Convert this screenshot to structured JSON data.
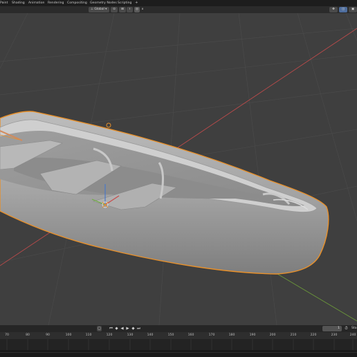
{
  "workspace_tabs": [
    "Paint",
    "Shading",
    "Animation",
    "Rendering",
    "Compositing",
    "Geometry Nodes",
    "Scripting"
  ],
  "add_tab": "+",
  "header": {
    "orientation_label": "Global",
    "orientation_options": [
      "Global"
    ]
  },
  "timeline": {
    "current_frame": "1",
    "start_label": "Sta",
    "ruler_ticks": [
      "70",
      "80",
      "90",
      "100",
      "110",
      "120",
      "130",
      "140",
      "150",
      "160",
      "170",
      "180",
      "190",
      "200",
      "210",
      "220",
      "230",
      "240"
    ]
  },
  "viewport": {
    "object": "rowboat",
    "selected": true,
    "outline_color": "#e8902a",
    "x_axis_color": "#b84a4a",
    "y_axis_color": "#6c9a3a"
  },
  "icons": [
    "object-origin-icon",
    "gizmo-arrows-icon",
    "transform-pivot-icon",
    "snap-icon",
    "proportional-edit-icon",
    "overlay-icon",
    "xray-icon",
    "view-icon",
    "keyframe-icon",
    "jump-start-icon",
    "play-icon",
    "play-reverse-icon",
    "jump-end-icon",
    "stopwatch-icon"
  ]
}
